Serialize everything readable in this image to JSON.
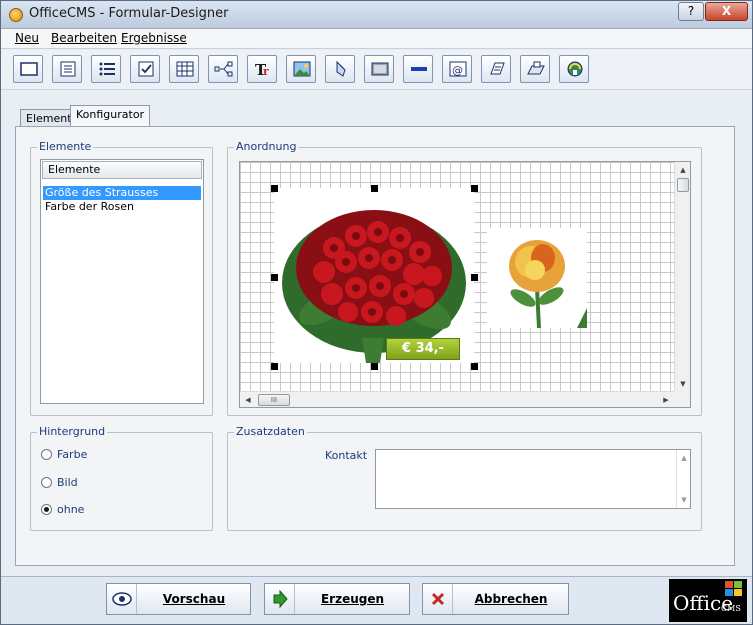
{
  "window": {
    "title": "OfficeCMS - Formular-Designer",
    "help_label": "?",
    "close_label": "X"
  },
  "menubar": {
    "items": [
      {
        "label": "Neu"
      },
      {
        "label": "Bearbeiten"
      },
      {
        "label": "Ergebnisse"
      }
    ]
  },
  "toolbar": {
    "tools": [
      "frame-icon",
      "text-block-icon",
      "list-icon",
      "checkbox-icon",
      "table-icon",
      "connector-icon",
      "text-format-icon",
      "image-icon",
      "pen-icon",
      "panel-icon",
      "line-icon",
      "email-icon",
      "note-icon",
      "shape-icon",
      "web-icon"
    ]
  },
  "tabs": [
    {
      "label": "Elemente",
      "active": false
    },
    {
      "label": "Konfigurator",
      "active": true
    }
  ],
  "elemente": {
    "group_label": "Elemente",
    "list_header": "Elemente",
    "items": [
      {
        "label": "Größe des Strausses",
        "selected": true
      },
      {
        "label": "Farbe der Rosen",
        "selected": false
      }
    ]
  },
  "anordnung": {
    "group_label": "Anordnung",
    "price_badge": "€ 34,-",
    "hscroll_thumb": "III"
  },
  "hintergrund": {
    "group_label": "Hintergrund",
    "options": [
      {
        "label": "Farbe",
        "selected": false
      },
      {
        "label": "Bild",
        "selected": false
      },
      {
        "label": "ohne",
        "selected": true
      }
    ]
  },
  "zusatzdaten": {
    "group_label": "Zusatzdaten",
    "field_label": "Kontakt",
    "field_value": ""
  },
  "actions": {
    "preview": "Vorschau",
    "create": "Erzeugen",
    "cancel": "Abbrechen"
  },
  "logo": {
    "main": "Office",
    "sub": "CMS"
  }
}
